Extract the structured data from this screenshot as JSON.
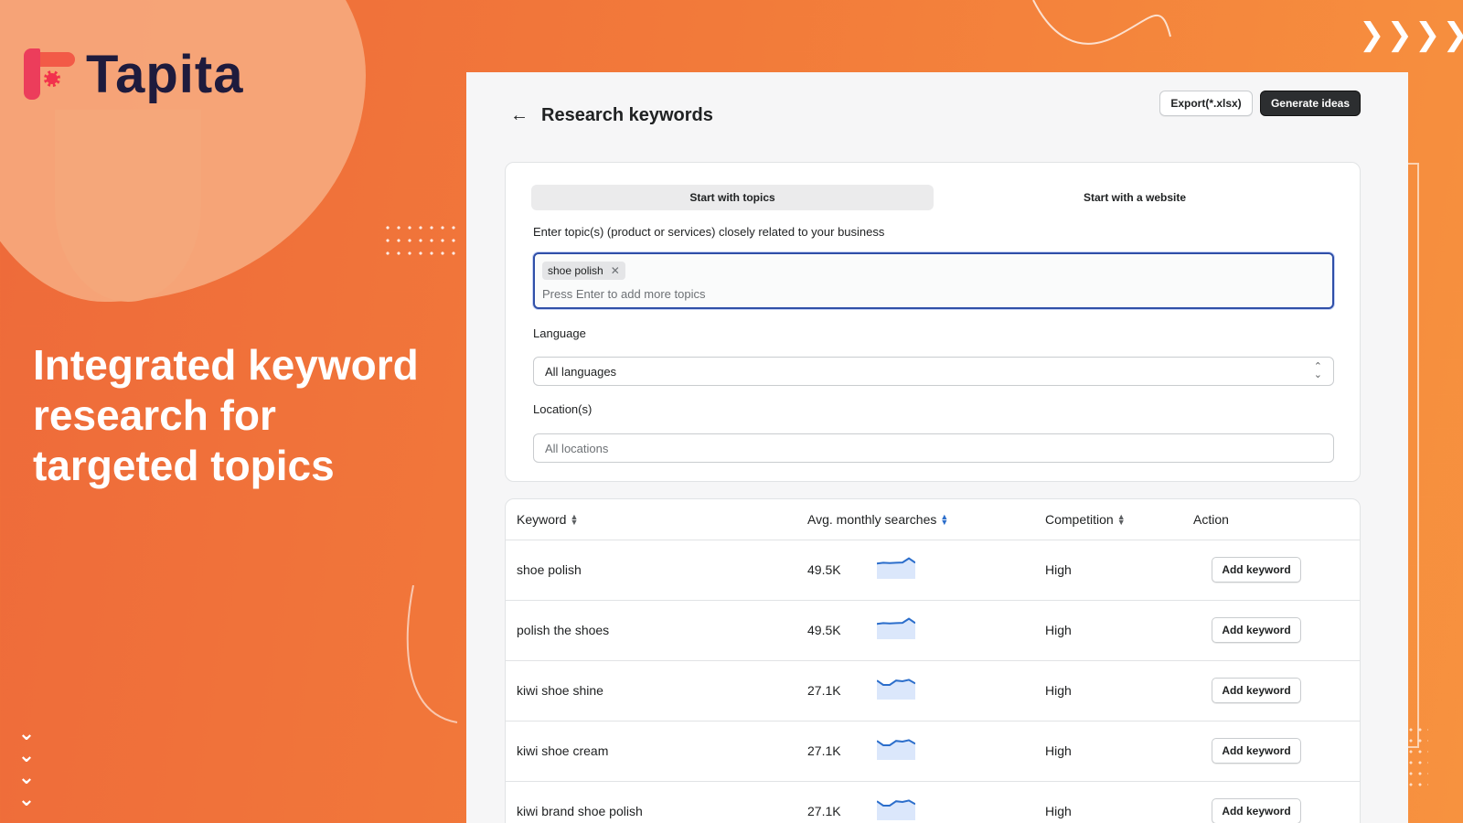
{
  "brand": {
    "name": "Tapita"
  },
  "headline": "Integrated keyword research for targeted topics",
  "page": {
    "title": "Research keywords",
    "export_label": "Export(*.xlsx)",
    "generate_label": "Generate ideas"
  },
  "tabs": [
    {
      "label": "Start with topics",
      "active": true
    },
    {
      "label": "Start with a website",
      "active": false
    }
  ],
  "form": {
    "topics_label": "Enter topic(s) (product or services) closely related to your business",
    "topics": [
      "shoe polish"
    ],
    "topics_placeholder": "Press Enter to add more topics",
    "language_label": "Language",
    "language_value": "All languages",
    "location_label": "Location(s)",
    "location_placeholder": "All locations"
  },
  "table": {
    "headers": {
      "keyword": "Keyword",
      "searches": "Avg. monthly searches",
      "competition": "Competition",
      "action": "Action"
    },
    "rows": [
      {
        "keyword": "shoe polish",
        "searches": "49.5K",
        "competition": "High",
        "action": "Add keyword",
        "trend": [
          0.55,
          0.6,
          0.58,
          0.6,
          0.62,
          0.9,
          0.6
        ]
      },
      {
        "keyword": "polish the shoes",
        "searches": "49.5K",
        "competition": "High",
        "action": "Add keyword",
        "trend": [
          0.55,
          0.6,
          0.58,
          0.6,
          0.62,
          0.9,
          0.6
        ]
      },
      {
        "keyword": "kiwi shoe shine",
        "searches": "27.1K",
        "competition": "High",
        "action": "Add keyword",
        "trend": [
          0.8,
          0.5,
          0.5,
          0.8,
          0.75,
          0.85,
          0.6
        ]
      },
      {
        "keyword": "kiwi shoe cream",
        "searches": "27.1K",
        "competition": "High",
        "action": "Add keyword",
        "trend": [
          0.8,
          0.5,
          0.5,
          0.8,
          0.75,
          0.85,
          0.6
        ]
      },
      {
        "keyword": "kiwi brand shoe polish",
        "searches": "27.1K",
        "competition": "High",
        "action": "Add keyword",
        "trend": [
          0.8,
          0.5,
          0.5,
          0.8,
          0.75,
          0.85,
          0.6
        ]
      }
    ]
  },
  "colors": {
    "accent": "#2c6ecb",
    "focus": "#2f4fa8",
    "brand_orange": "#f27a3a"
  },
  "icons": [
    "back-arrow-icon",
    "close-icon",
    "select-arrows-icon",
    "sort-icon",
    "chevron-right-icon",
    "chevron-down-icon"
  ]
}
